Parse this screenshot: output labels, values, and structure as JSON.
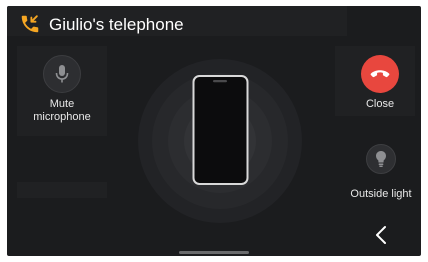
{
  "header": {
    "title": "Giulio's telephone",
    "icon": "phone-callback-icon",
    "icon_color": "#f5a623"
  },
  "actions": {
    "mute": {
      "label": "Mute\nmicrophone",
      "icon": "microphone-icon"
    },
    "close": {
      "label": "Close",
      "icon": "hang-up-icon",
      "color": "#e8473e"
    },
    "outside_light": {
      "label": "Outside light",
      "icon": "light-bulb-icon"
    }
  },
  "center": {
    "icon": "smartphone-icon"
  },
  "navigation": {
    "back_icon": "chevron-left-icon"
  },
  "colors": {
    "background": "#1b1c1e",
    "panel": "#202123",
    "text": "#ffffff"
  }
}
